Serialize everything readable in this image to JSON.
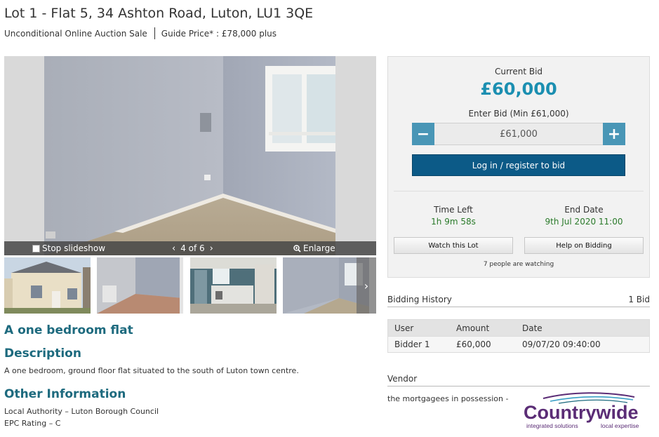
{
  "lot": {
    "title": "Lot 1 - Flat 5, 34 Ashton Road, Luton, LU1 3QE",
    "sale_type": "Unconditional Online Auction Sale",
    "guide_price": "Guide Price* : £78,000 plus"
  },
  "gallery": {
    "stop_slideshow": "Stop slideshow",
    "counter": "4 of 6",
    "prev": "‹",
    "next": "›",
    "enlarge": "Enlarge",
    "thumb_next": "›"
  },
  "summary": "A one bedroom flat",
  "description": {
    "heading": "Description",
    "text": "A one bedroom, ground floor flat situated to the south of Luton town centre."
  },
  "other_info": {
    "heading": "Other Information",
    "local_authority": "Local Authority – Luton Borough Council",
    "epc": "EPC Rating – C"
  },
  "bidding": {
    "current_bid_label": "Current Bid",
    "current_bid": "£60,000",
    "enter_bid_label": "Enter Bid (Min £61,000)",
    "bid_value": "£61,000",
    "minus": "−",
    "plus": "+",
    "login_button": "Log in / register to bid",
    "time_left_label": "Time Left",
    "time_left": "1h 9m 58s",
    "end_date_label": "End Date",
    "end_date": "9th Jul 2020 11:00",
    "watch_button": "Watch this Lot",
    "help_button": "Help on Bidding",
    "watching": "7 people are watching"
  },
  "history": {
    "heading": "Bidding History",
    "count": "1 Bid",
    "columns": [
      "User",
      "Amount",
      "Date"
    ],
    "rows": [
      {
        "user": "Bidder 1",
        "amount": "£60,000",
        "date": "09/07/20 09:40:00"
      }
    ]
  },
  "vendor": {
    "heading": "Vendor",
    "text": "the mortgagees in possession -",
    "logo_name": "Countrywide",
    "logo_tag_left": "integrated solutions",
    "logo_tag_right": "local expertise"
  },
  "colors": {
    "accent_teal": "#1b8fb1",
    "heading_teal": "#1d6a7e",
    "login_blue": "#0c5a87",
    "stepper_blue": "#4996b6",
    "green_value": "#2a7a2a",
    "logo_purple": "#5b2d76"
  },
  "icons": {
    "enlarge": "magnifier-plus-icon",
    "prev": "chevron-left-icon",
    "next": "chevron-right-icon",
    "checkbox": "checkbox-icon"
  }
}
